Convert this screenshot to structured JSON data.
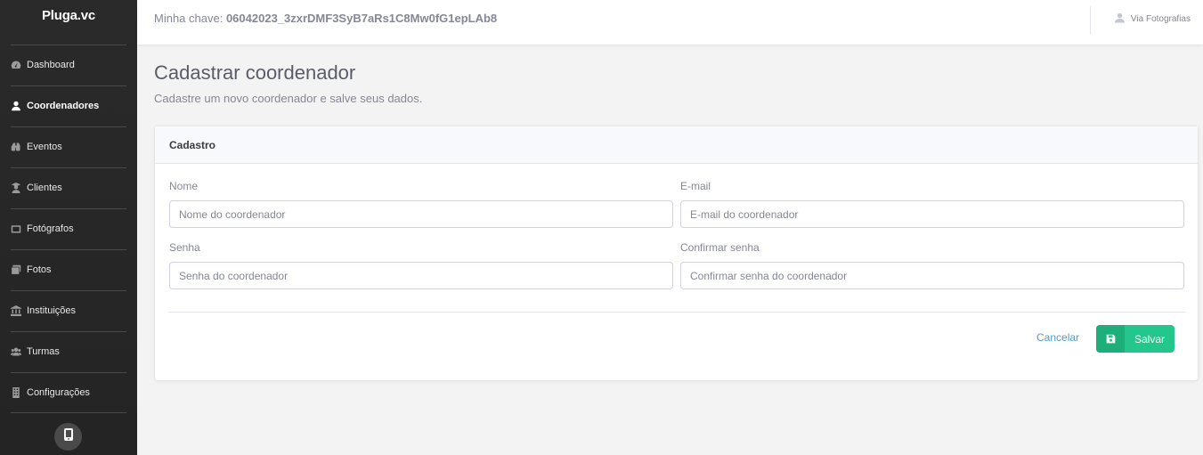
{
  "brand": {
    "name": "Pluga.vc"
  },
  "sidebar": {
    "items": [
      {
        "label": "Dashboard",
        "icon": "dashboard-icon"
      },
      {
        "label": "Coordenadores",
        "icon": "user-icon",
        "active": true
      },
      {
        "label": "Eventos",
        "icon": "binoculars-icon"
      },
      {
        "label": "Clientes",
        "icon": "user-graduate-icon"
      },
      {
        "label": "Fotógrafos",
        "icon": "camera-icon"
      },
      {
        "label": "Fotos",
        "icon": "images-icon"
      },
      {
        "label": "Instituições",
        "icon": "university-icon"
      },
      {
        "label": "Turmas",
        "icon": "users-icon"
      },
      {
        "label": "Configurações",
        "icon": "building-icon"
      }
    ],
    "mobile_icon": "mobile-icon"
  },
  "topbar": {
    "key_label": "Minha chave:",
    "key_value": "06042023_3zxrDMF3SyB7aRs1C8Mw0fG1epLAb8",
    "user_name": "Via Fotografias"
  },
  "page": {
    "title": "Cadastrar coordenador",
    "subtitle": "Cadastre um novo coordenador e salve seus dados."
  },
  "form": {
    "card_title": "Cadastro",
    "name": {
      "label": "Nome",
      "placeholder": "Nome do coordenador",
      "value": ""
    },
    "email": {
      "label": "E-mail",
      "placeholder": "E-mail do coordenador",
      "value": ""
    },
    "password": {
      "label": "Senha",
      "placeholder": "Senha do coordenador",
      "value": ""
    },
    "confirm": {
      "label": "Confirmar senha",
      "placeholder": "Confirmar senha do coordenador",
      "value": ""
    },
    "cancel_label": "Cancelar",
    "save_label": "Salvar"
  },
  "colors": {
    "sidebar_bg": "#2a2a2a",
    "accent_green": "#23c68b",
    "link_blue": "#4e9dd1"
  }
}
